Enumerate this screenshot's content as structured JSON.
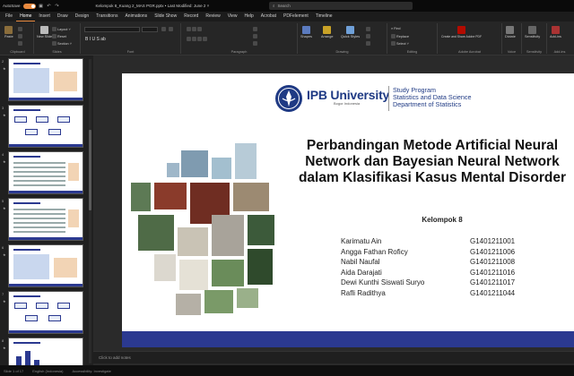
{
  "window": {
    "autosave_label": "AutoSave",
    "autosave_state": "On",
    "doc_title": "Kelompok 8_Kuang 2_MAS PGR.pptx  •  Last Modified: June 2 ˅",
    "search_placeholder": "Search"
  },
  "menu": {
    "tabs": [
      "File",
      "Home",
      "Insert",
      "Draw",
      "Design",
      "Transitions",
      "Animations",
      "Slide Show",
      "Record",
      "Review",
      "View",
      "Help",
      "Acrobat",
      "PDFelement",
      "Timeline"
    ],
    "active": "Home"
  },
  "ribbon": {
    "groups": {
      "clipboard": "Clipboard",
      "slides": "Slides",
      "font": "Font",
      "paragraph": "Paragraph",
      "drawing": "Drawing",
      "editing": "Editing",
      "adobe": "Adobe Acrobat",
      "voice": "Voice",
      "sensitivity": "Sensitivity",
      "addins": "Add-ins"
    },
    "buttons": {
      "paste": "Paste",
      "new_slide": "New Slide",
      "layout": "Layout ˅",
      "reset": "Reset",
      "section": "Section ˅",
      "shapes": "Shapes",
      "arrange": "Arrange",
      "quick_styles": "Quick Styles",
      "find": "Find",
      "replace": "Replace",
      "select": "Select ˅",
      "create_share": "Create and Share Adobe PDF",
      "dictate": "Dictate",
      "sensitivity": "Sensitivity",
      "addins": "Add-ins"
    },
    "format_row": "B  I  U  S  ab",
    "icon_names": [
      "paste-icon",
      "new-slide-icon",
      "shapes-icon",
      "arrange-icon",
      "find-icon",
      "pdf-icon",
      "mic-icon",
      "shield-icon",
      "addins-icon"
    ]
  },
  "thumbnails": {
    "numbers": [
      "2",
      "3",
      "4",
      "5",
      "6",
      "7",
      "8"
    ]
  },
  "slide": {
    "logo_name": "IPB University",
    "logo_sub": "Bogor Indonesia",
    "dept_lines": [
      "Study Program",
      "Statistics and Data Science",
      "Department of Statistics"
    ],
    "title": "Perbandingan Metode Artificial Neural Network dan Bayesian Neural Network dalam Klasifikasi Kasus Mental Disorder",
    "group": "Kelompok 8",
    "members": [
      {
        "name": "Karimatu Ain",
        "id": "G1401211001"
      },
      {
        "name": "Angga Fathan Roficy",
        "id": "G1401211006"
      },
      {
        "name": "Nabil Naufal",
        "id": "G1401211008"
      },
      {
        "name": "Aida Darajati",
        "id": "G1401211016"
      },
      {
        "name": "Dewi Kunthi Siswati Suryo",
        "id": "G1401211017"
      },
      {
        "name": "Rafli Radithya",
        "id": "G1401211044"
      }
    ],
    "brand_color": "#2b3990"
  },
  "notes": {
    "placeholder": "Click to add notes"
  },
  "status": {
    "slide_info": "Slide 1 of 17",
    "language": "English (Indonesia)",
    "accessibility": "Accessibility: Investigate"
  }
}
